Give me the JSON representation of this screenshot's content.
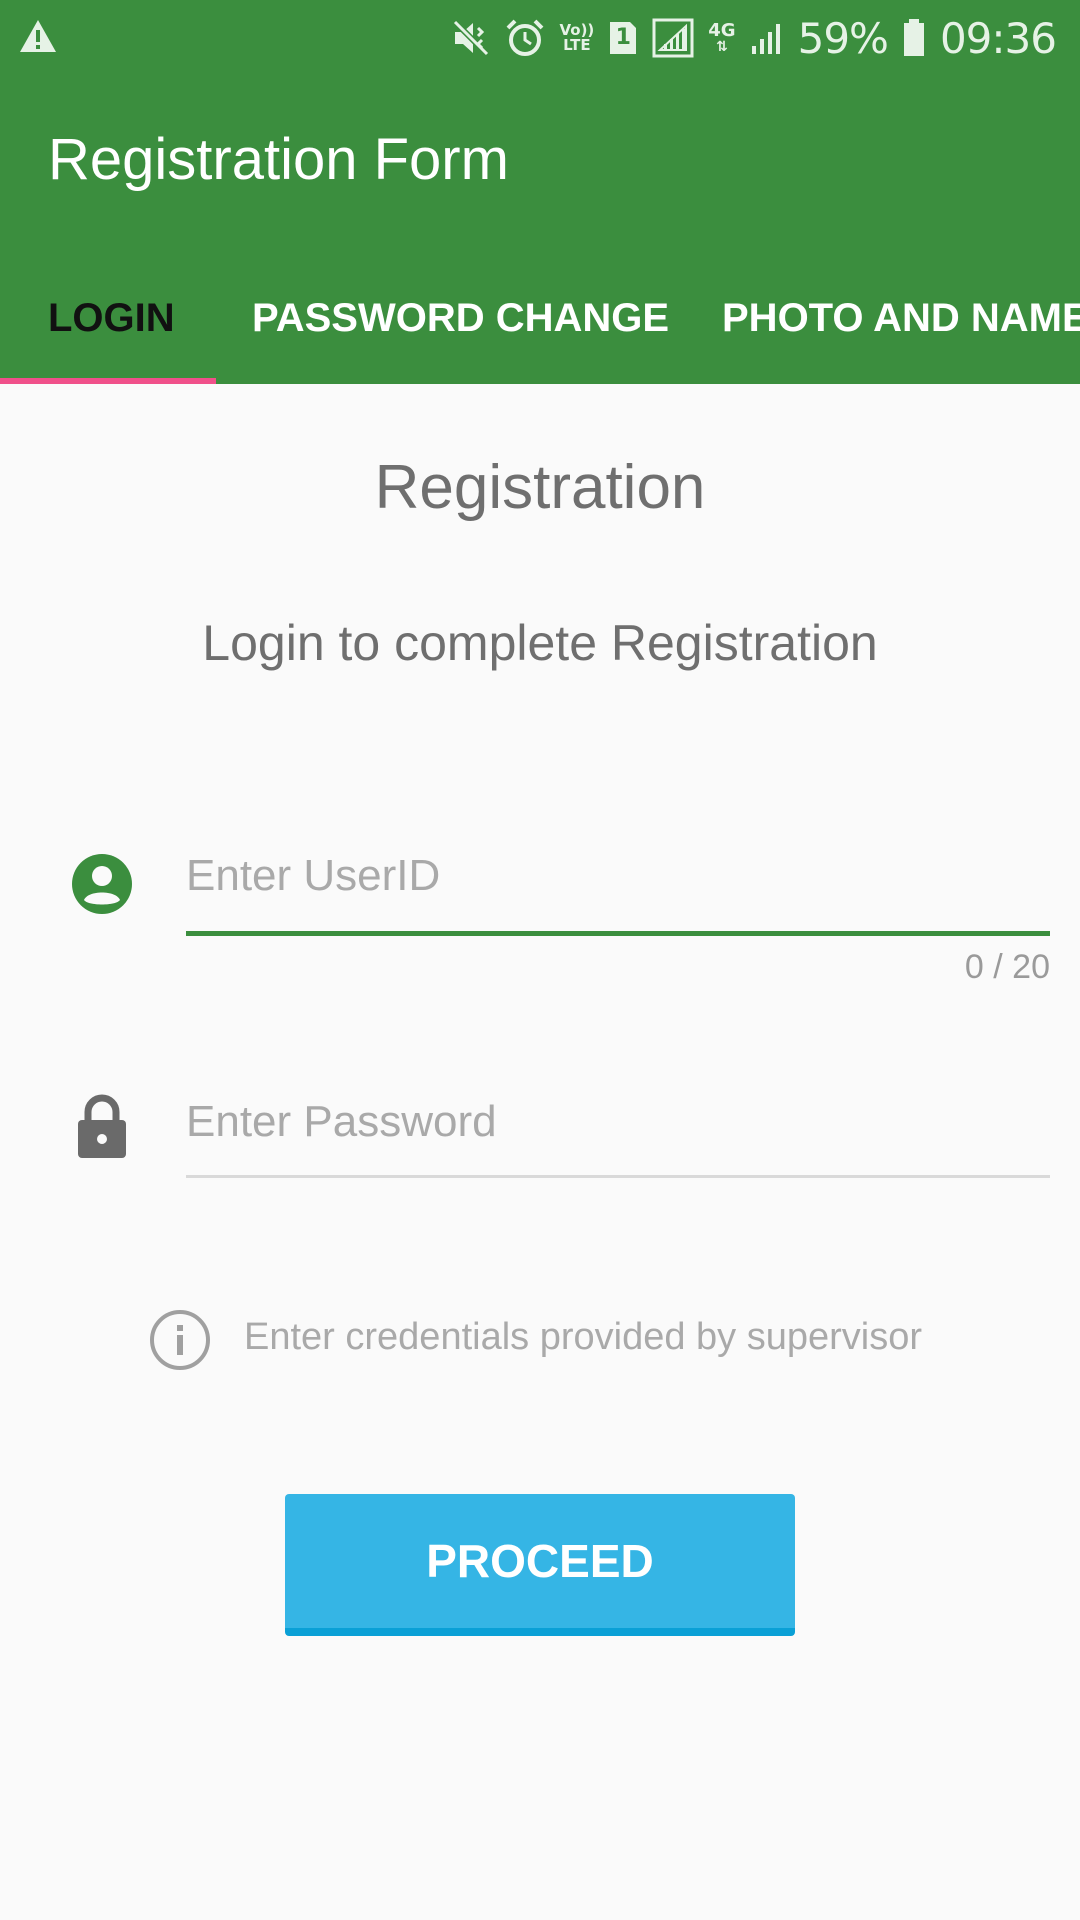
{
  "status_bar": {
    "battery": "59%",
    "time": "09:36",
    "network_type": "4G",
    "volte_top": "Vo))",
    "volte_bottom": "LTE",
    "sim_number": "1",
    "icons": [
      "warning-icon",
      "mute-icon",
      "alarm-icon",
      "volte-icon",
      "sim-icon",
      "signal-icon",
      "data-4g-icon",
      "signal-icon",
      "battery-icon"
    ]
  },
  "app_bar": {
    "title": "Registration Form",
    "tabs": [
      {
        "label": "LOGIN",
        "active": true
      },
      {
        "label": "PASSWORD CHANGE",
        "active": false
      },
      {
        "label": "PHOTO AND NAME",
        "active": false
      }
    ]
  },
  "content": {
    "heading": "Registration",
    "subheading": "Login to complete Registration",
    "userid_field": {
      "placeholder": "Enter UserID",
      "value": "",
      "counter": "0 / 20",
      "icon": "account-circle-icon"
    },
    "password_field": {
      "placeholder": "Enter Password",
      "value": "",
      "icon": "lock-icon"
    },
    "hint": {
      "text": "Enter credentials provided by supervisor",
      "icon": "info-icon"
    },
    "proceed_label": "PROCEED"
  },
  "colors": {
    "primary": "#3b8e3e",
    "tab_indicator": "#f0508a",
    "button": "#35b5e5",
    "button_shadow": "#0aa0d6",
    "background": "#fafafa"
  }
}
